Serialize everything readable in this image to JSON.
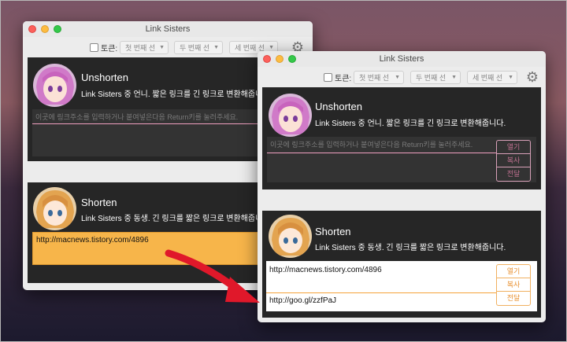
{
  "app_title": "Link Sisters",
  "toolbar": {
    "toggle_label": "토큰:",
    "select1": "첫 번째 선",
    "select2": "두 번째 선",
    "select3": "세 번째 선"
  },
  "unshorten": {
    "title": "Unshorten",
    "desc": "Link Sisters 중 언니. 짧은 링크를 긴 링크로 변환해줍니다.",
    "placeholder": "이곳에 링크주소를 입력하거나 붙여넣은다음 Return키를 눌러주세요."
  },
  "shorten": {
    "title": "Shorten",
    "desc": "Link Sisters 중 동생. 긴 링크를 짧은 링크로 변환해줍니다.",
    "input_value": "http://macnews.tistory.com/4896",
    "output_value": "http://goo.gl/zzfPaJ"
  },
  "buttons": {
    "open": "열기",
    "copy": "복사",
    "send": "전달"
  },
  "colors": {
    "pink_accent": "#f0a0c0",
    "orange_accent": "#f5a23a",
    "highlight_fill": "#f7b54a",
    "arrow": "#e0182a"
  }
}
